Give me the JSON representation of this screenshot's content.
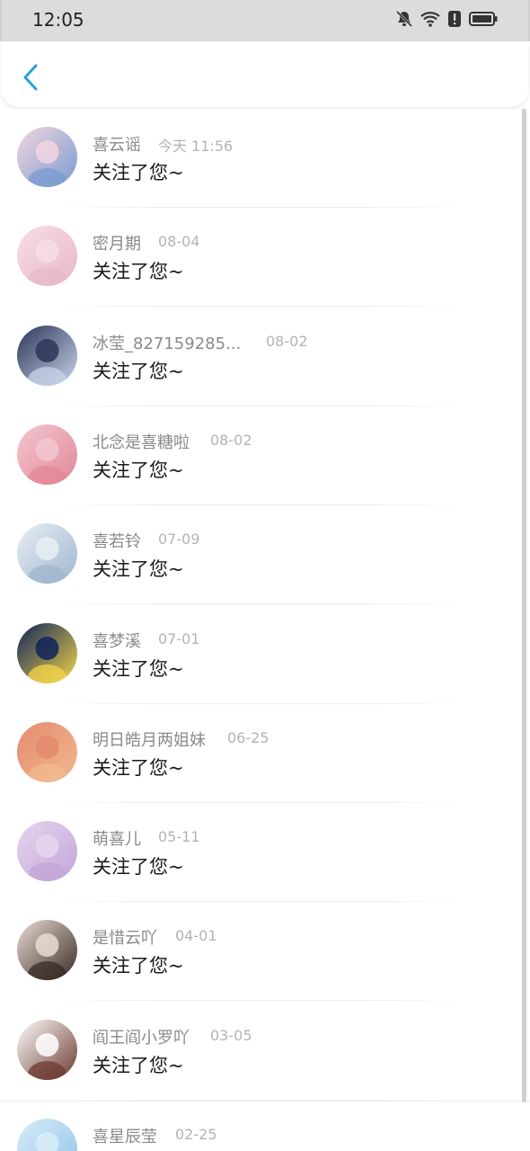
{
  "status_bar": {
    "time": "12:05",
    "icons": [
      "bell-off-icon",
      "wifi-icon",
      "alert-icon",
      "battery-icon"
    ]
  },
  "header": {
    "back_icon": "chevron-left-icon",
    "accent_color": "#2a9fe0"
  },
  "notifications": [
    {
      "name": "喜云谣",
      "date": "今天 11:56",
      "message": "关注了您~",
      "avatar_colors": [
        "#f3d5e0",
        "#7a9bd0"
      ]
    },
    {
      "name": "密月期",
      "date": "08-04",
      "message": "关注了您~",
      "avatar_colors": [
        "#f7dde4",
        "#e9b8c8"
      ]
    },
    {
      "name": "冰莹_827159285...",
      "date": "08-02",
      "message": "关注了您~",
      "avatar_colors": [
        "#2b3658",
        "#c8d4ea"
      ]
    },
    {
      "name": "北念是喜糖啦",
      "date": "08-02",
      "message": "关注了您~",
      "avatar_colors": [
        "#f2c7cf",
        "#e38798"
      ]
    },
    {
      "name": "喜若铃",
      "date": "07-09",
      "message": "关注了您~",
      "avatar_colors": [
        "#e8eef5",
        "#9fb6cf"
      ]
    },
    {
      "name": "喜梦溪",
      "date": "07-01",
      "message": "关注了您~",
      "avatar_colors": [
        "#10235a",
        "#f4d64a"
      ]
    },
    {
      "name": "明日皓月两姐妹",
      "date": "06-25",
      "message": "关注了您~",
      "avatar_colors": [
        "#e48a6e",
        "#f2b98f"
      ]
    },
    {
      "name": "萌喜儿",
      "date": "05-11",
      "message": "关注了您~",
      "avatar_colors": [
        "#e6d5ee",
        "#c2a5d8"
      ]
    },
    {
      "name": "是惜云吖",
      "date": "04-01",
      "message": "关注了您~",
      "avatar_colors": [
        "#eadbd4",
        "#3a2a25"
      ]
    },
    {
      "name": "阎王阎小罗吖",
      "date": "03-05",
      "message": "关注了您~",
      "avatar_colors": [
        "#ffffff",
        "#6b3a2e"
      ]
    },
    {
      "name": "喜星辰莹",
      "date": "02-25",
      "message": "",
      "avatar_colors": [
        "#d9ecf8",
        "#8fc4ea"
      ]
    }
  ]
}
